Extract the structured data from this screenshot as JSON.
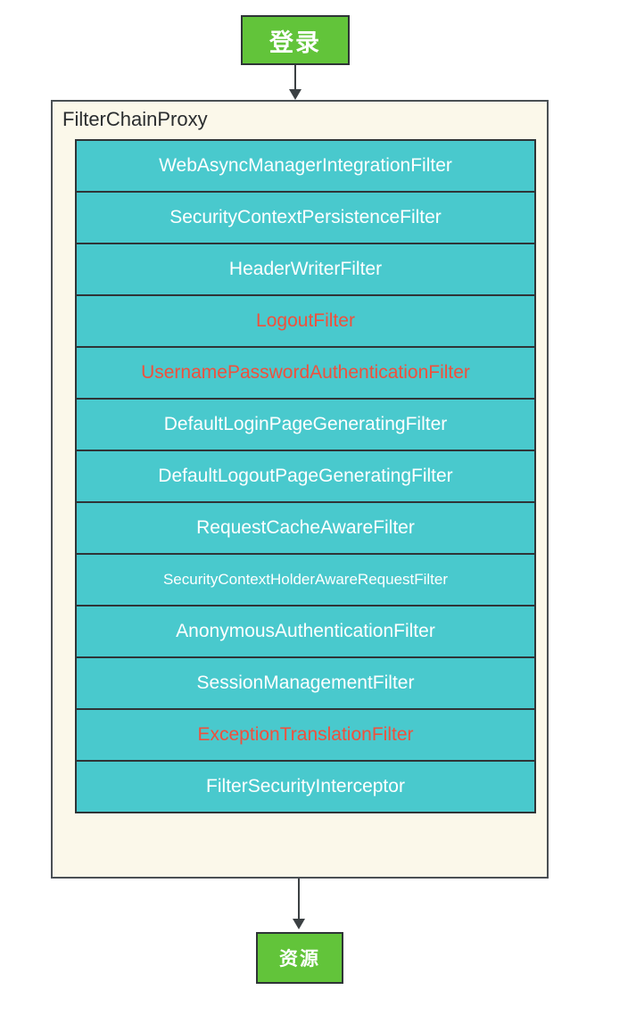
{
  "entry_node": {
    "label": "登录"
  },
  "exit_node": {
    "label": "资源"
  },
  "container": {
    "title": "FilterChainProxy"
  },
  "colors": {
    "green_node": "#62c43a",
    "filter_fill": "#49c9cd",
    "container_fill": "#fbf8ea",
    "border": "#2f3436",
    "text_default": "#ffffff",
    "text_highlight": "#f0503c"
  },
  "filters": [
    {
      "label": "WebAsyncManagerIntegrationFilter",
      "style": "default"
    },
    {
      "label": "SecurityContextPersistenceFilter",
      "style": "default"
    },
    {
      "label": "HeaderWriterFilter",
      "style": "default"
    },
    {
      "label": "LogoutFilter",
      "style": "highlight"
    },
    {
      "label": "UsernamePasswordAuthenticationFilter",
      "style": "highlight"
    },
    {
      "label": "DefaultLoginPageGeneratingFilter",
      "style": "default"
    },
    {
      "label": "DefaultLogoutPageGeneratingFilter",
      "style": "default"
    },
    {
      "label": "RequestCacheAwareFilter",
      "style": "default"
    },
    {
      "label": "SecurityContextHolderAwareRequestFilter",
      "style": "small"
    },
    {
      "label": "AnonymousAuthenticationFilter",
      "style": "default"
    },
    {
      "label": "SessionManagementFilter",
      "style": "default"
    },
    {
      "label": "ExceptionTranslationFilter",
      "style": "highlight"
    },
    {
      "label": "FilterSecurityInterceptor",
      "style": "default"
    }
  ]
}
